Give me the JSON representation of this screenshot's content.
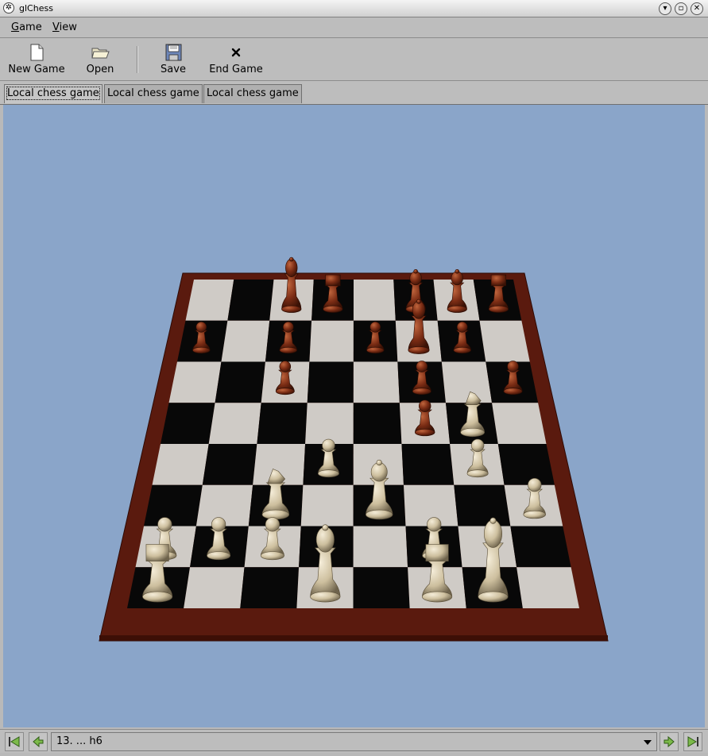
{
  "window": {
    "title": "glChess"
  },
  "menu": [
    {
      "label": "Game",
      "mnemonic": "G",
      "rest": "ame"
    },
    {
      "label": "View",
      "mnemonic": "V",
      "rest": "iew"
    }
  ],
  "toolbar": {
    "new_game": "New Game",
    "open": "Open",
    "save": "Save",
    "end_game": "End Game"
  },
  "tabs": [
    {
      "label": "Local chess game",
      "active": true
    },
    {
      "label": "Local chess game",
      "active": false
    },
    {
      "label": "Local chess game",
      "active": false
    }
  ],
  "status": {
    "current_move": "13. ... h6"
  },
  "colors": {
    "viewport_bg": "#8aa5c9",
    "board_frame": "#5a1a0e",
    "light_square": "#cfcbc6",
    "dark_square": "#080808",
    "dark_piece": "#7a2c14",
    "light_piece": "#cdbf9e"
  }
}
